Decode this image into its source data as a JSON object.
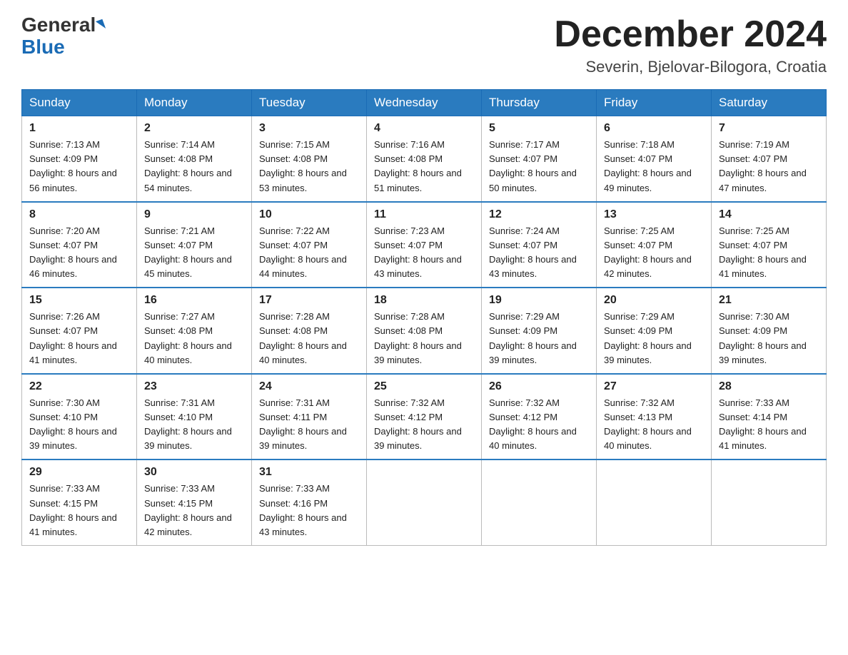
{
  "header": {
    "logo_general": "General",
    "logo_blue": "Blue",
    "month_title": "December 2024",
    "location": "Severin, Bjelovar-Bilogora, Croatia"
  },
  "days_of_week": [
    "Sunday",
    "Monday",
    "Tuesday",
    "Wednesday",
    "Thursday",
    "Friday",
    "Saturday"
  ],
  "weeks": [
    [
      {
        "day": "1",
        "sunrise": "7:13 AM",
        "sunset": "4:09 PM",
        "daylight": "8 hours and 56 minutes."
      },
      {
        "day": "2",
        "sunrise": "7:14 AM",
        "sunset": "4:08 PM",
        "daylight": "8 hours and 54 minutes."
      },
      {
        "day": "3",
        "sunrise": "7:15 AM",
        "sunset": "4:08 PM",
        "daylight": "8 hours and 53 minutes."
      },
      {
        "day": "4",
        "sunrise": "7:16 AM",
        "sunset": "4:08 PM",
        "daylight": "8 hours and 51 minutes."
      },
      {
        "day": "5",
        "sunrise": "7:17 AM",
        "sunset": "4:07 PM",
        "daylight": "8 hours and 50 minutes."
      },
      {
        "day": "6",
        "sunrise": "7:18 AM",
        "sunset": "4:07 PM",
        "daylight": "8 hours and 49 minutes."
      },
      {
        "day": "7",
        "sunrise": "7:19 AM",
        "sunset": "4:07 PM",
        "daylight": "8 hours and 47 minutes."
      }
    ],
    [
      {
        "day": "8",
        "sunrise": "7:20 AM",
        "sunset": "4:07 PM",
        "daylight": "8 hours and 46 minutes."
      },
      {
        "day": "9",
        "sunrise": "7:21 AM",
        "sunset": "4:07 PM",
        "daylight": "8 hours and 45 minutes."
      },
      {
        "day": "10",
        "sunrise": "7:22 AM",
        "sunset": "4:07 PM",
        "daylight": "8 hours and 44 minutes."
      },
      {
        "day": "11",
        "sunrise": "7:23 AM",
        "sunset": "4:07 PM",
        "daylight": "8 hours and 43 minutes."
      },
      {
        "day": "12",
        "sunrise": "7:24 AM",
        "sunset": "4:07 PM",
        "daylight": "8 hours and 43 minutes."
      },
      {
        "day": "13",
        "sunrise": "7:25 AM",
        "sunset": "4:07 PM",
        "daylight": "8 hours and 42 minutes."
      },
      {
        "day": "14",
        "sunrise": "7:25 AM",
        "sunset": "4:07 PM",
        "daylight": "8 hours and 41 minutes."
      }
    ],
    [
      {
        "day": "15",
        "sunrise": "7:26 AM",
        "sunset": "4:07 PM",
        "daylight": "8 hours and 41 minutes."
      },
      {
        "day": "16",
        "sunrise": "7:27 AM",
        "sunset": "4:08 PM",
        "daylight": "8 hours and 40 minutes."
      },
      {
        "day": "17",
        "sunrise": "7:28 AM",
        "sunset": "4:08 PM",
        "daylight": "8 hours and 40 minutes."
      },
      {
        "day": "18",
        "sunrise": "7:28 AM",
        "sunset": "4:08 PM",
        "daylight": "8 hours and 39 minutes."
      },
      {
        "day": "19",
        "sunrise": "7:29 AM",
        "sunset": "4:09 PM",
        "daylight": "8 hours and 39 minutes."
      },
      {
        "day": "20",
        "sunrise": "7:29 AM",
        "sunset": "4:09 PM",
        "daylight": "8 hours and 39 minutes."
      },
      {
        "day": "21",
        "sunrise": "7:30 AM",
        "sunset": "4:09 PM",
        "daylight": "8 hours and 39 minutes."
      }
    ],
    [
      {
        "day": "22",
        "sunrise": "7:30 AM",
        "sunset": "4:10 PM",
        "daylight": "8 hours and 39 minutes."
      },
      {
        "day": "23",
        "sunrise": "7:31 AM",
        "sunset": "4:10 PM",
        "daylight": "8 hours and 39 minutes."
      },
      {
        "day": "24",
        "sunrise": "7:31 AM",
        "sunset": "4:11 PM",
        "daylight": "8 hours and 39 minutes."
      },
      {
        "day": "25",
        "sunrise": "7:32 AM",
        "sunset": "4:12 PM",
        "daylight": "8 hours and 39 minutes."
      },
      {
        "day": "26",
        "sunrise": "7:32 AM",
        "sunset": "4:12 PM",
        "daylight": "8 hours and 40 minutes."
      },
      {
        "day": "27",
        "sunrise": "7:32 AM",
        "sunset": "4:13 PM",
        "daylight": "8 hours and 40 minutes."
      },
      {
        "day": "28",
        "sunrise": "7:33 AM",
        "sunset": "4:14 PM",
        "daylight": "8 hours and 41 minutes."
      }
    ],
    [
      {
        "day": "29",
        "sunrise": "7:33 AM",
        "sunset": "4:15 PM",
        "daylight": "8 hours and 41 minutes."
      },
      {
        "day": "30",
        "sunrise": "7:33 AM",
        "sunset": "4:15 PM",
        "daylight": "8 hours and 42 minutes."
      },
      {
        "day": "31",
        "sunrise": "7:33 AM",
        "sunset": "4:16 PM",
        "daylight": "8 hours and 43 minutes."
      },
      null,
      null,
      null,
      null
    ]
  ]
}
